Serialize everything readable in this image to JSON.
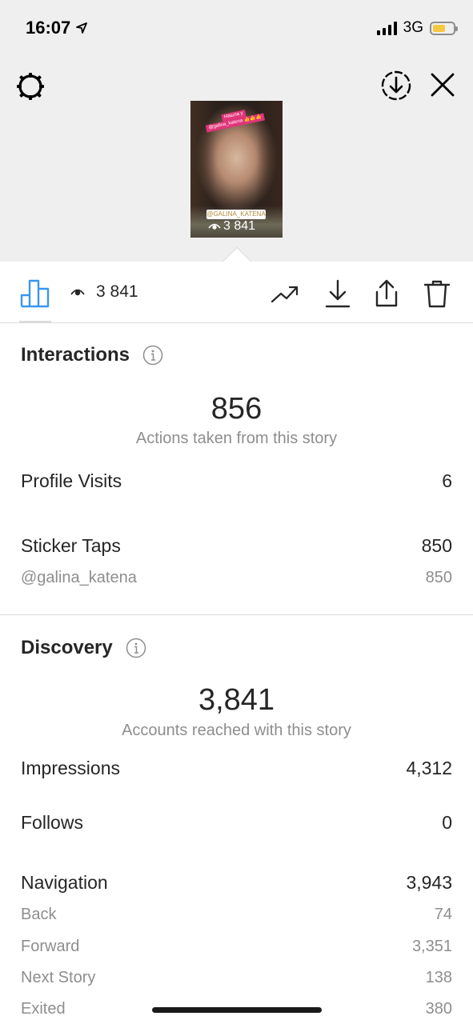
{
  "status_bar": {
    "time": "16:07",
    "network": "3G",
    "battery_color": "#f5c842"
  },
  "header": {
    "icons": [
      "settings-icon",
      "download-circle-icon",
      "close-icon"
    ]
  },
  "story": {
    "sticker_text_line1": "Нашла у",
    "sticker_text_line2": "@galina_katena 👍👍👍",
    "mention_sticker": "@GALINA_KATENA",
    "views": "3 841"
  },
  "toolbar": {
    "views": "3 841",
    "icons": [
      "bar-chart-icon",
      "eye-icon",
      "trending-icon",
      "download-icon",
      "share-icon",
      "trash-icon"
    ],
    "accent_color": "#3897f0"
  },
  "interactions": {
    "title": "Interactions",
    "total": "856",
    "caption": "Actions taken from this story",
    "rows": [
      {
        "label": "Profile Visits",
        "value": "6"
      },
      {
        "label": "Sticker Taps",
        "value": "850"
      }
    ],
    "sub_rows": [
      {
        "label": "@galina_katena",
        "value": "850"
      }
    ]
  },
  "discovery": {
    "title": "Discovery",
    "total": "3,841",
    "caption": "Accounts reached with this story",
    "rows": [
      {
        "label": "Impressions",
        "value": "4,312"
      },
      {
        "label": "Follows",
        "value": "0"
      },
      {
        "label": "Navigation",
        "value": "3,943"
      }
    ],
    "navigation_breakdown": [
      {
        "label": "Back",
        "value": "74"
      },
      {
        "label": "Forward",
        "value": "3,351"
      },
      {
        "label": "Next Story",
        "value": "138"
      },
      {
        "label": "Exited",
        "value": "380"
      }
    ]
  }
}
